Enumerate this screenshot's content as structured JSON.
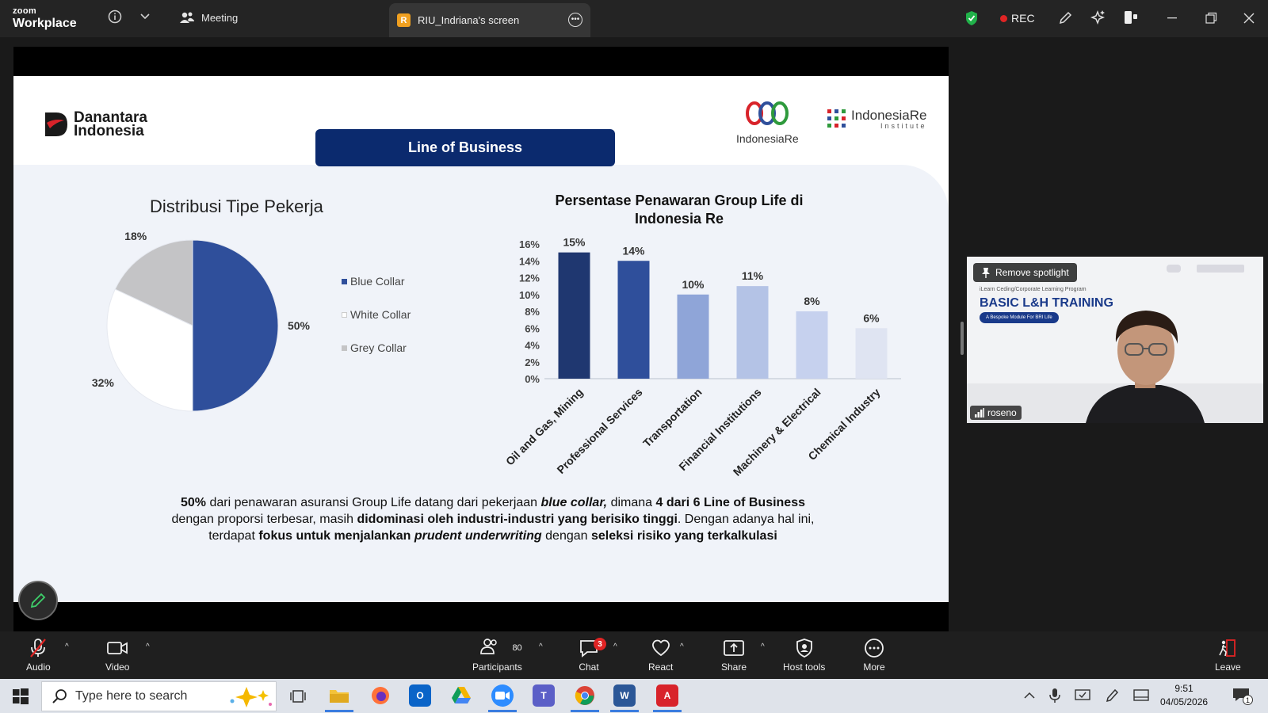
{
  "window": {
    "brand_small": "zoom",
    "brand_name": "Workplace",
    "meeting_label": "Meeting",
    "tab_badge": "R",
    "tab_label": "RIU_Indriana's screen",
    "rec_label": "REC"
  },
  "slide": {
    "logo_danantara": [
      "Danantara",
      "Indonesia"
    ],
    "banner": "Line of Business",
    "logo_indonesiare": "IndonesiaRe",
    "logo_institute": "IndonesiaRe",
    "logo_institute_sub": "Institute",
    "summary_html": "<b>50%</b> dari penawaran asuransi Group Life datang dari pekerjaan <b><i>blue collar,</i></b> dimana <b>4 dari 6 Line of Business</b> dengan proporsi terbesar, masih <b>didominasi oleh industri-industri yang berisiko tinggi</b>. Dengan adanya hal ini, terdapat <b>fokus untuk menjalankan <i>prudent underwriting</i></b> dengan <b>seleksi risiko yang terkalkulasi</b>"
  },
  "chart_data": [
    {
      "type": "pie",
      "title": "Distribusi Tipe Pekerja",
      "labels": [
        "Blue Collar",
        "White Collar",
        "Grey Collar"
      ],
      "values": [
        50,
        32,
        18
      ],
      "value_labels": [
        "50%",
        "32%",
        "18%"
      ],
      "colors": [
        "#2f4f9b",
        "#ffffff",
        "#c4c4c6"
      ],
      "legend": "right"
    },
    {
      "type": "bar",
      "title": "Persentase Penawaran Group Life di Indonesia Re",
      "categories": [
        "Oil and Gas, Mining",
        "Professional Services",
        "Transportation",
        "Financial Institutions",
        "Machinery & Electrical",
        "Chemical Industry"
      ],
      "values": [
        15,
        14,
        10,
        11,
        8,
        6
      ],
      "value_labels": [
        "15%",
        "14%",
        "10%",
        "11%",
        "8%",
        "6%"
      ],
      "colors": [
        "#1f3770",
        "#2f4f9b",
        "#8fa5d8",
        "#b4c3e6",
        "#c6d1ee",
        "#dfe4f2"
      ],
      "ylim": [
        0,
        16
      ],
      "yticks": [
        "0%",
        "2%",
        "4%",
        "6%",
        "8%",
        "10%",
        "12%",
        "14%",
        "16%"
      ],
      "grid": false
    }
  ],
  "video": {
    "spotlight_label": "Remove spotlight",
    "program_text": "iLearn Ceding/Corporate Learning Program",
    "title": "BASIC L&H TRAINING",
    "subtitle": "A Bespoke Module For BRI Life",
    "participant_name": "roseno"
  },
  "toolbar": {
    "audio": "Audio",
    "video": "Video",
    "participants": "Participants",
    "participants_count": "80",
    "chat": "Chat",
    "chat_badge": "3",
    "react": "React",
    "share": "Share",
    "host_tools": "Host tools",
    "more": "More",
    "leave": "Leave"
  },
  "taskbar": {
    "search_placeholder": "Type here to search",
    "time": "9:51",
    "date": "04/05/2026",
    "notification_count": "1"
  }
}
